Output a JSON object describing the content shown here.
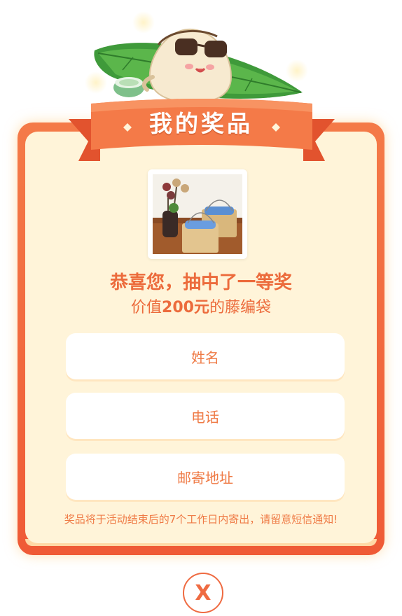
{
  "modal": {
    "title": "我的奖品",
    "congrats": "恭喜您，抽中了一等奖",
    "prize_prefix": "价值",
    "prize_amount": "200元",
    "prize_suffix": "的藤编袋"
  },
  "form": {
    "name_placeholder": "姓名",
    "phone_placeholder": "电话",
    "address_placeholder": "邮寄地址"
  },
  "notice": "奖品将于活动结束后的7个工作日内寄出，请留意短信通知!",
  "close_label": "X",
  "icons": {
    "mascot": "rice-dumpling-mascot-icon",
    "leaf": "bamboo-leaf-icon",
    "cup": "tea-cup-icon",
    "close": "close-icon"
  },
  "colors": {
    "accent": "#ef7a45",
    "frame": "#f26a3f",
    "panel": "#fff4d9"
  }
}
